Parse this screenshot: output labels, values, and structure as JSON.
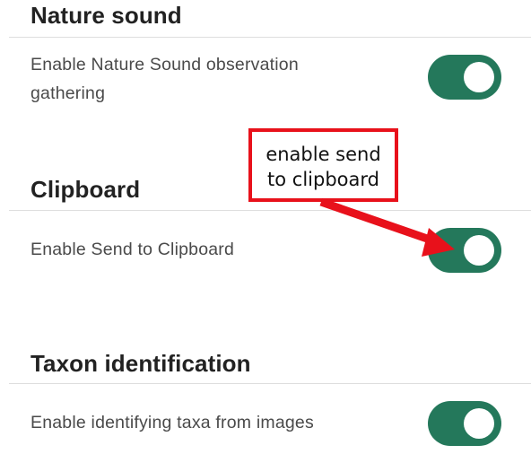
{
  "sections": {
    "nature_sound": {
      "title": "Nature sound",
      "setting_label": "Enable Nature Sound observation\ngathering",
      "toggle_on": true
    },
    "clipboard": {
      "title": "Clipboard",
      "setting_label": "Enable Send to Clipboard",
      "toggle_on": true
    },
    "taxon_identification": {
      "title": "Taxon identification",
      "setting_label": "Enable identifying taxa from images",
      "toggle_on": true
    }
  },
  "annotation": {
    "text": "enable send\nto clipboard",
    "color": "#e8111b"
  },
  "colors": {
    "toggle_on": "#24785b",
    "divider": "#dedede",
    "title": "#222222",
    "label": "#4a4a4a"
  }
}
